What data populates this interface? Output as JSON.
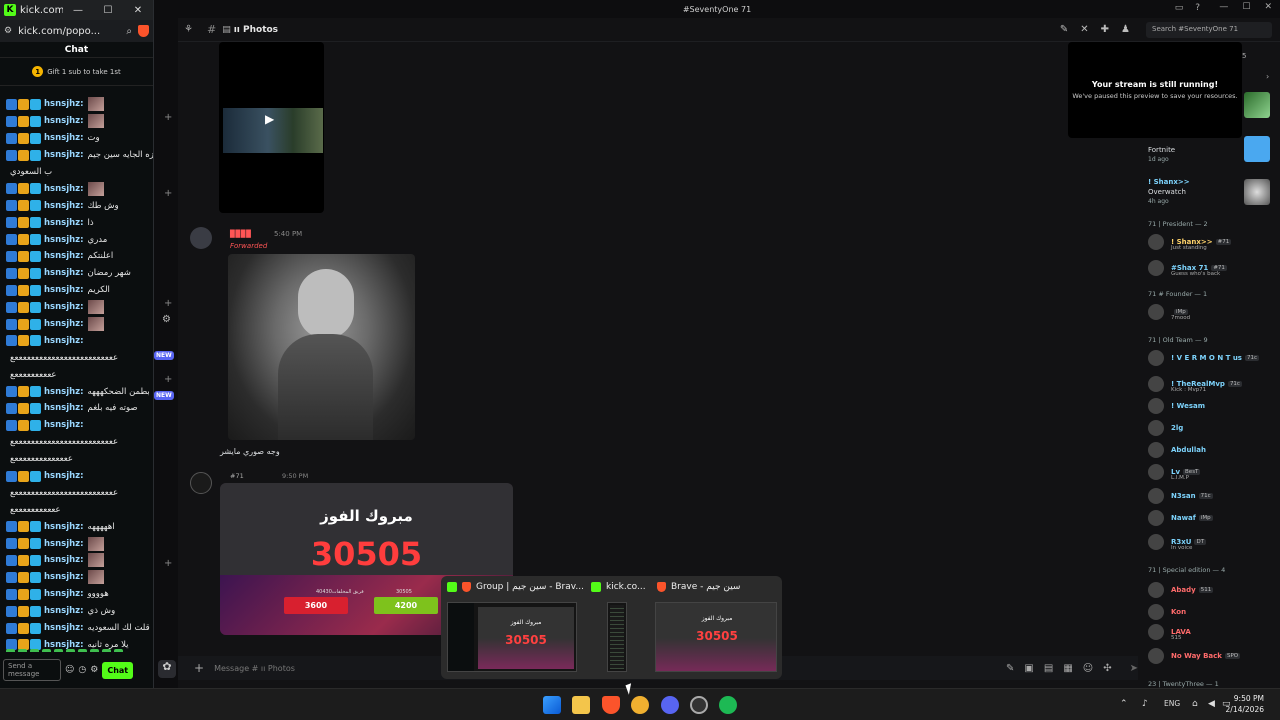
{
  "kick": {
    "title": "kick.com/p...",
    "url": "kick.com/popo...",
    "chat_header": "Chat",
    "gift_text": "Gift 1 sub to take 1st",
    "gift_count": "1",
    "messages": [
      {
        "user": "hsnsjhz:",
        "text": "",
        "thumb": true
      },
      {
        "user": "hsnsjhz:",
        "text": "",
        "thumb": true
      },
      {
        "user": "hsnsjhz:",
        "text": "وت",
        "thumb": false
      },
      {
        "user": "hsnsjhz:",
        "text": "المزه الجايه سين جيم",
        "thumb": false
      },
      {
        "user": "",
        "text": "ب السعودي",
        "thumb": false
      },
      {
        "user": "hsnsjhz:",
        "text": "",
        "thumb": true
      },
      {
        "user": "hsnsjhz:",
        "text": "وش طك",
        "thumb": false
      },
      {
        "user": "hsnsjhz:",
        "text": "ذا",
        "thumb": false
      },
      {
        "user": "hsnsjhz:",
        "text": "مدري",
        "thumb": false
      },
      {
        "user": "hsnsjhz:",
        "text": "اعلنتكم",
        "thumb": false
      },
      {
        "user": "hsnsjhz:",
        "text": "شهر رمضان",
        "thumb": false
      },
      {
        "user": "hsnsjhz:",
        "text": "الكريم",
        "thumb": false
      },
      {
        "user": "hsnsjhz:",
        "text": "",
        "thumb": true
      },
      {
        "user": "hsnsjhz:",
        "text": "",
        "thumb": true
      },
      {
        "user": "hsnsjhz:",
        "text": "",
        "thumb": false
      },
      {
        "user": "",
        "text": "عععععععععععععععععععععععععع",
        "thumb": false
      },
      {
        "user": "",
        "text": "ععععععععععع",
        "thumb": false
      },
      {
        "user": "hsnsjhz:",
        "text": "بطمن الضحكهههه",
        "thumb": false
      },
      {
        "user": "hsnsjhz:",
        "text": "صوته فيه بلغم",
        "thumb": false
      },
      {
        "user": "hsnsjhz:",
        "text": "",
        "thumb": false
      },
      {
        "user": "",
        "text": "عععععععععععععععععععععععععع",
        "thumb": false
      },
      {
        "user": "",
        "text": "ععععععععععععععع",
        "thumb": false
      },
      {
        "user": "hsnsjhz:",
        "text": "",
        "thumb": false
      },
      {
        "user": "",
        "text": "عععععععععععععععععععععععععع",
        "thumb": false
      },
      {
        "user": "",
        "text": "عععععععععععع",
        "thumb": false
      },
      {
        "user": "hsnsjhz:",
        "text": "اهههههه",
        "thumb": false
      },
      {
        "user": "hsnsjhz:",
        "text": "",
        "thumb": true
      },
      {
        "user": "hsnsjhz:",
        "text": "",
        "thumb": true
      },
      {
        "user": "hsnsjhz:",
        "text": "",
        "thumb": true
      },
      {
        "user": "hsnsjhz:",
        "text": "هوووو",
        "thumb": false
      },
      {
        "user": "hsnsjhz:",
        "text": "وش ذي",
        "thumb": false
      },
      {
        "user": "hsnsjhz:",
        "text": "قلت لك السعوديه",
        "thumb": false
      },
      {
        "user": "hsnsjhz:",
        "text": "يلا مره ثانيه",
        "thumb": false
      }
    ],
    "last_msg": {
      "user": "GLA129:",
      "text": "السلام عليييييييكم"
    },
    "send_placeholder": "Send a message",
    "chat_button": "Chat"
  },
  "discord": {
    "window_title": "#SeventyOne 71",
    "channel": "ıı Photos",
    "search_placeholder": "Search #SeventyOne 71",
    "message1": {
      "time": "5:40 PM",
      "forwarded": "Forwarded",
      "caption": "وجه صوري مايشر"
    },
    "message2": {
      "tag": "#71",
      "time": "9:50 PM"
    },
    "win_card": {
      "title": "مبروك الفوز",
      "number": "30505",
      "label_left": "فريق المخلفات40430",
      "label_right": "30505",
      "value_left": "3600",
      "value_right": "4200"
    },
    "input_placeholder": "Message # ıı Photos",
    "stream_title": "Your stream is still running!",
    "stream_sub": "We've paused this preview to save your resources.",
    "new_badge": "NEW",
    "activities": [
      {
        "name": "Fortnite",
        "sub": "1d ago"
      },
      {
        "name": "! Shanx>>",
        "sub": ""
      },
      {
        "name": "Overwatch",
        "sub": "4h ago"
      }
    ],
    "count_5": "5",
    "sections": {
      "president": "71 | President — 2",
      "founder": "71 # Founder — 1",
      "old_team": "71 | Old Team — 9",
      "special": "71 | Special edition — 4",
      "twenty_three": "23 | TwentyThree — 1"
    },
    "members": [
      {
        "name": "! Shanx>>",
        "tag": "#71",
        "status": "Just standing",
        "color": "#ffd36b"
      },
      {
        "name": "#Shax 71",
        "tag": "#71",
        "status": "Guess who's back",
        "color": "#7dd3fc"
      },
      {
        "name": "",
        "tag": "iMp",
        "status": "7mood",
        "color": "#dbdee1"
      },
      {
        "name": "! V E R M O N T us",
        "tag": "71c",
        "status": "",
        "color": "#7dd3fc"
      },
      {
        "name": "! TheRealMvp",
        "tag": "71c",
        "status": "Kick : Mvp71",
        "color": "#7dd3fc"
      },
      {
        "name": "! Wesam",
        "tag": "",
        "status": "",
        "color": "#7dd3fc"
      },
      {
        "name": "2lg",
        "tag": "",
        "status": "",
        "color": "#7dd3fc"
      },
      {
        "name": "Abdullah",
        "tag": "",
        "status": "",
        "color": "#7dd3fc"
      },
      {
        "name": "Lv",
        "tag": "BesT",
        "status": "L.I.M.P",
        "color": "#7dd3fc"
      },
      {
        "name": "N3san",
        "tag": "71c",
        "status": "",
        "color": "#7dd3fc"
      },
      {
        "name": "Nawaf",
        "tag": "iMp",
        "status": "",
        "color": "#7dd3fc"
      },
      {
        "name": "R3xU",
        "tag": "DT",
        "status": "In voice",
        "color": "#7dd3fc"
      },
      {
        "name": "Abady",
        "tag": "511",
        "status": "",
        "color": "#ff6b6b"
      },
      {
        "name": "Kon",
        "tag": "",
        "status": "",
        "color": "#ff6b6b"
      },
      {
        "name": "LAVA",
        "tag": "",
        "status": "515",
        "color": "#ff6b6b"
      },
      {
        "name": "No Way Back",
        "tag": "SPO",
        "status": "",
        "color": "#ff6b6b"
      }
    ]
  },
  "previews": [
    {
      "label": "Group | سين جيم - Brav...",
      "icon": "kick"
    },
    {
      "label": "kick.co...",
      "icon": "kick"
    },
    {
      "label": "Brave - سين جيم",
      "icon": "brave"
    }
  ],
  "preview_number": "30505",
  "preview_sub": "مبروك الفوز",
  "taskbar": {
    "lang": "ENG",
    "time": "9:50 PM",
    "date": "2/14/2026"
  }
}
